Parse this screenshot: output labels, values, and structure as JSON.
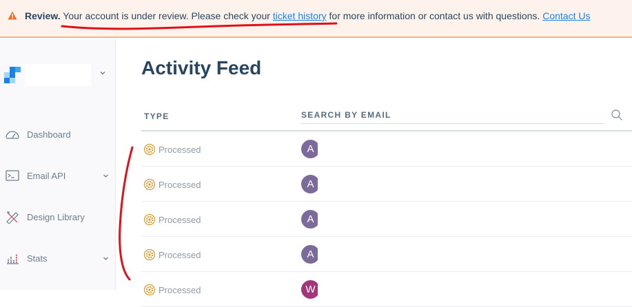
{
  "banner": {
    "label": "Review.",
    "text_before": " Your account is under review. Please check your ",
    "link_ticket": "ticket history",
    "text_after": " for more information or contact us with questions. ",
    "link_contact": "Contact Us",
    "icon": "warning-icon"
  },
  "sidebar": {
    "logo": "sendgrid-logo",
    "items": [
      {
        "label": "Dashboard",
        "icon": "gauge-icon",
        "has_chevron": false
      },
      {
        "label": "Email API",
        "icon": "terminal-icon",
        "has_chevron": true
      },
      {
        "label": "Design Library",
        "icon": "pencil-ruler-icon",
        "has_chevron": false
      },
      {
        "label": "Stats",
        "icon": "bar-chart-icon",
        "has_chevron": true
      }
    ]
  },
  "main": {
    "title": "Activity Feed",
    "columns": {
      "type": "TYPE",
      "email": "SEARCH BY EMAIL"
    },
    "rows": [
      {
        "status": "Processed",
        "avatar": "A",
        "avatar_color": "#7b6a9a"
      },
      {
        "status": "Processed",
        "avatar": "A",
        "avatar_color": "#7b6a9a"
      },
      {
        "status": "Processed",
        "avatar": "A",
        "avatar_color": "#7b6a9a"
      },
      {
        "status": "Processed",
        "avatar": "A",
        "avatar_color": "#7b6a9a"
      },
      {
        "status": "Processed",
        "avatar": "W",
        "avatar_color": "#a3357b"
      }
    ]
  },
  "colors": {
    "accent": "#1a82e2",
    "heading": "#294661",
    "warning": "#e8742d",
    "gear": "#d99a2b",
    "annotation": "#e0101a"
  }
}
